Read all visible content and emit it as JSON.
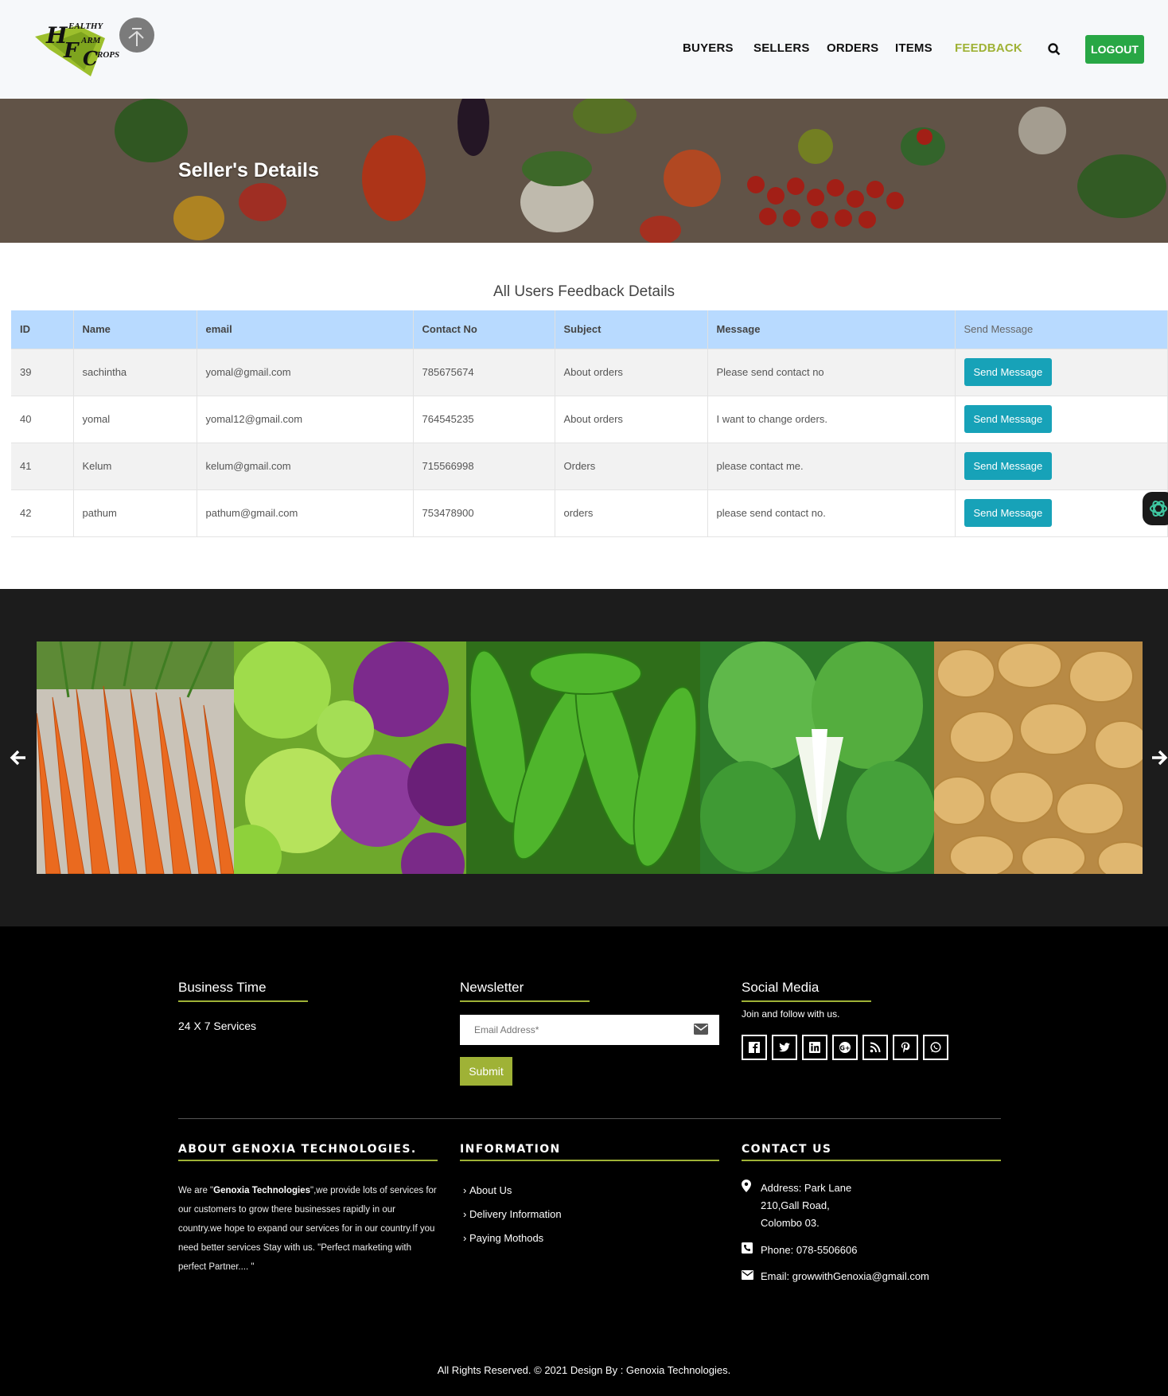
{
  "header": {
    "logo_text": "HEALTHY FARM CROPS",
    "nav": [
      {
        "label": "BUYERS"
      },
      {
        "label": "SELLERS"
      },
      {
        "label": "ORDERS"
      },
      {
        "label": "ITEMS"
      },
      {
        "label": "FEEDBACK",
        "active": true
      }
    ],
    "search_icon": "search-icon",
    "logout_label": "LOGOUT"
  },
  "banner": {
    "title": "Seller's Details"
  },
  "feedback": {
    "section_title": "All Users Feedback Details",
    "columns": [
      "ID",
      "Name",
      "email",
      "Contact No",
      "Subject",
      "Message",
      "Send Message"
    ],
    "rows": [
      {
        "id": "39",
        "name": "sachintha",
        "email": "yomal@gmail.com",
        "contact": "785675674",
        "subject": "About orders",
        "message": "Please send contact no",
        "action": "Send Message"
      },
      {
        "id": "40",
        "name": "yomal",
        "email": "yomal12@gmail.com",
        "contact": "764545235",
        "subject": "About orders",
        "message": "I want to change orders.",
        "action": "Send Message"
      },
      {
        "id": "41",
        "name": "Kelum",
        "email": "kelum@gmail.com",
        "contact": "715566998",
        "subject": "Orders",
        "message": "please contact me.",
        "action": "Send Message"
      },
      {
        "id": "42",
        "name": "pathum",
        "email": "pathum@gmail.com",
        "contact": "753478900",
        "subject": "orders",
        "message": "please send contact no.",
        "action": "Send Message"
      }
    ]
  },
  "gallery": {
    "images": [
      "carrots",
      "cabbage",
      "bitter-gourd",
      "bok-choy",
      "potatoes"
    ],
    "prev_icon": "arrow-left-icon",
    "next_icon": "arrow-right-icon"
  },
  "footer": {
    "business": {
      "title": "Business Time",
      "text": "24 X 7 Services"
    },
    "newsletter": {
      "title": "Newsletter",
      "placeholder": "Email Address*",
      "submit_label": "Submit"
    },
    "social": {
      "title": "Social Media",
      "text": "Join and follow with us.",
      "icons": [
        "facebook-icon",
        "twitter-icon",
        "linkedin-icon",
        "google-plus-icon",
        "rss-icon",
        "pinterest-icon",
        "whatsapp-icon"
      ]
    },
    "about": {
      "title": "ABOUT GENOXIA TECHNOLOGIES.",
      "text_pre": "We are \"",
      "text_brand": "Genoxia Technologies",
      "text_post": "\",we provide lots of services for our customers to grow there businesses rapidly in our country.we hope to expand our services for in our country.If you need better services Stay with us. \"Perfect marketing with perfect Partner.... \""
    },
    "information": {
      "title": "INFORMATION",
      "links": [
        "About Us",
        "Delivery Information",
        "Paying Mothods"
      ]
    },
    "contact": {
      "title": "CONTACT US",
      "address_lines": [
        "Address: Park Lane",
        "210,Gall Road,",
        "Colombo 03."
      ],
      "phone": "Phone: 078-5506606",
      "email": "Email: growwithGenoxia@gmail.com"
    },
    "copyright": "All Rights Reserved. © 2021 Design By : Genoxia Technologies."
  },
  "colors": {
    "accent": "#9fb236",
    "logout_green": "#28a745",
    "table_header": "#b8daff",
    "send_button": "#17a2b8"
  }
}
